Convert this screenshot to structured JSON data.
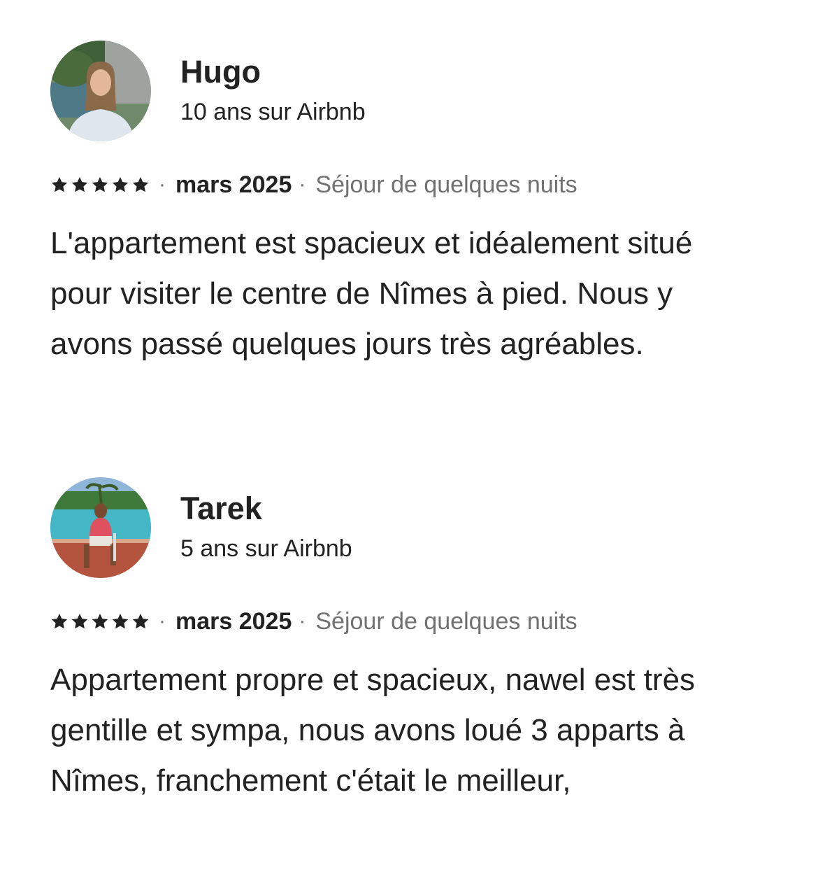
{
  "reviews": [
    {
      "name": "Hugo",
      "tenure": "10 ans sur Airbnb",
      "rating": 5,
      "date": "mars 2025",
      "stay": "Séjour de quelques nuits",
      "text": "L'appartement est spacieux et idéalement situé pour visiter le centre de Nîmes à pied. Nous y avons passé quelques jours très agréables."
    },
    {
      "name": "Tarek",
      "tenure": "5 ans sur Airbnb",
      "rating": 5,
      "date": "mars 2025",
      "stay": "Séjour de quelques nuits",
      "text": "Appartement propre et spacieux, nawel est très gentille et sympa, nous avons loué 3 apparts à Nîmes, franchement c'était le meilleur,"
    }
  ],
  "separator": "·",
  "icons": {
    "star": "star-icon"
  },
  "colors": {
    "primary_text": "#222222",
    "secondary_text": "#717171"
  }
}
